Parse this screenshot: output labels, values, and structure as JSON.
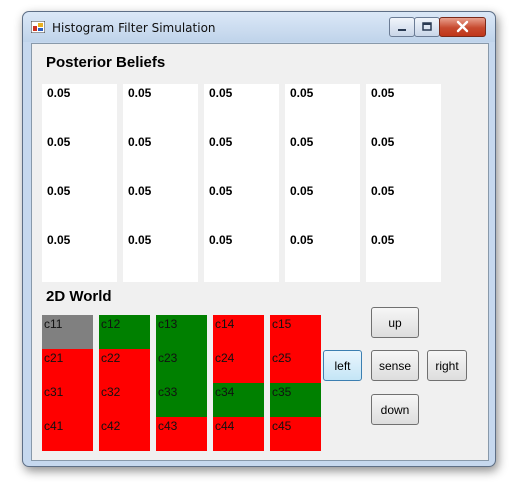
{
  "window": {
    "title": "Histogram Filter Simulation",
    "controls": [
      "minimize-icon",
      "maximize-icon",
      "close-icon"
    ]
  },
  "posterior": {
    "title": "Posterior Beliefs",
    "rows": [
      [
        "0.05",
        "0.05",
        "0.05",
        "0.05",
        "0.05"
      ],
      [
        "0.05",
        "0.05",
        "0.05",
        "0.05",
        "0.05"
      ],
      [
        "0.05",
        "0.05",
        "0.05",
        "0.05",
        "0.05"
      ],
      [
        "0.05",
        "0.05",
        "0.05",
        "0.05",
        "0.05"
      ]
    ]
  },
  "world": {
    "title": "2D World",
    "colors": {
      "red": "#ff0000",
      "green": "#008000",
      "gray": "#808080"
    },
    "grid": [
      [
        {
          "label": "c11",
          "color": "gray"
        },
        {
          "label": "c12",
          "color": "green"
        },
        {
          "label": "c13",
          "color": "green"
        },
        {
          "label": "c14",
          "color": "red"
        },
        {
          "label": "c15",
          "color": "red"
        }
      ],
      [
        {
          "label": "c21",
          "color": "red"
        },
        {
          "label": "c22",
          "color": "red"
        },
        {
          "label": "c23",
          "color": "green"
        },
        {
          "label": "c24",
          "color": "red"
        },
        {
          "label": "c25",
          "color": "red"
        }
      ],
      [
        {
          "label": "c31",
          "color": "red"
        },
        {
          "label": "c32",
          "color": "red"
        },
        {
          "label": "c33",
          "color": "green"
        },
        {
          "label": "c34",
          "color": "green"
        },
        {
          "label": "c35",
          "color": "green"
        }
      ],
      [
        {
          "label": "c41",
          "color": "red"
        },
        {
          "label": "c42",
          "color": "red"
        },
        {
          "label": "c43",
          "color": "red"
        },
        {
          "label": "c44",
          "color": "red"
        },
        {
          "label": "c45",
          "color": "red"
        }
      ]
    ]
  },
  "controls": {
    "up": "up",
    "left": "left",
    "sense": "sense",
    "right": "right",
    "down": "down"
  }
}
